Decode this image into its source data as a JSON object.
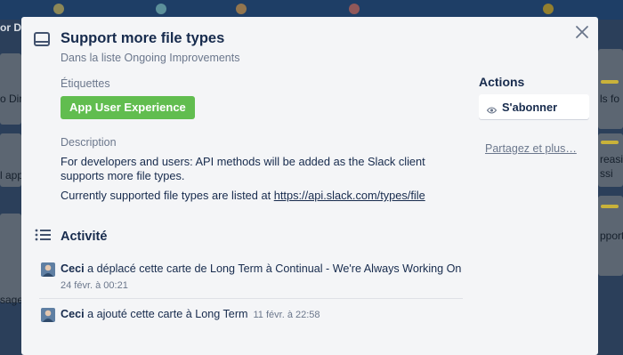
{
  "background": {
    "left_texts": [
      "or D",
      "o Dir",
      "l app",
      "sage"
    ],
    "right_texts": [
      "ls fo",
      "reasi",
      "ssi",
      "pport"
    ]
  },
  "card": {
    "title": "Support more file types",
    "list_context": "Dans la liste Ongoing Improvements",
    "labels_heading": "Étiquettes",
    "label_tag": "App User Experience",
    "label_color": "#61bd4f",
    "description_heading": "Description",
    "description_p1": "For developers and users: API methods will be added as the Slack client supports more file types.",
    "description_p2_prefix": "Currently supported file types are listed at ",
    "description_link": "https://api.slack.com/types/file"
  },
  "activity": {
    "heading": "Activité",
    "items": [
      {
        "user": "Ceci",
        "text": " a déplacé cette carte de Long Term à Continual - We're Always Working On",
        "date": "24 févr. à 00:21"
      },
      {
        "user": "Ceci",
        "text": " a ajouté cette carte à Long Term",
        "date": "11 févr. à 22:58"
      }
    ]
  },
  "sidebar": {
    "heading": "Actions",
    "subscribe_label": "S'abonner",
    "share_label": "Partagez et plus…"
  },
  "icons": {
    "close": "close-icon",
    "card": "card-icon",
    "activity": "activity-list-icon",
    "subscribe": "eye-icon"
  }
}
